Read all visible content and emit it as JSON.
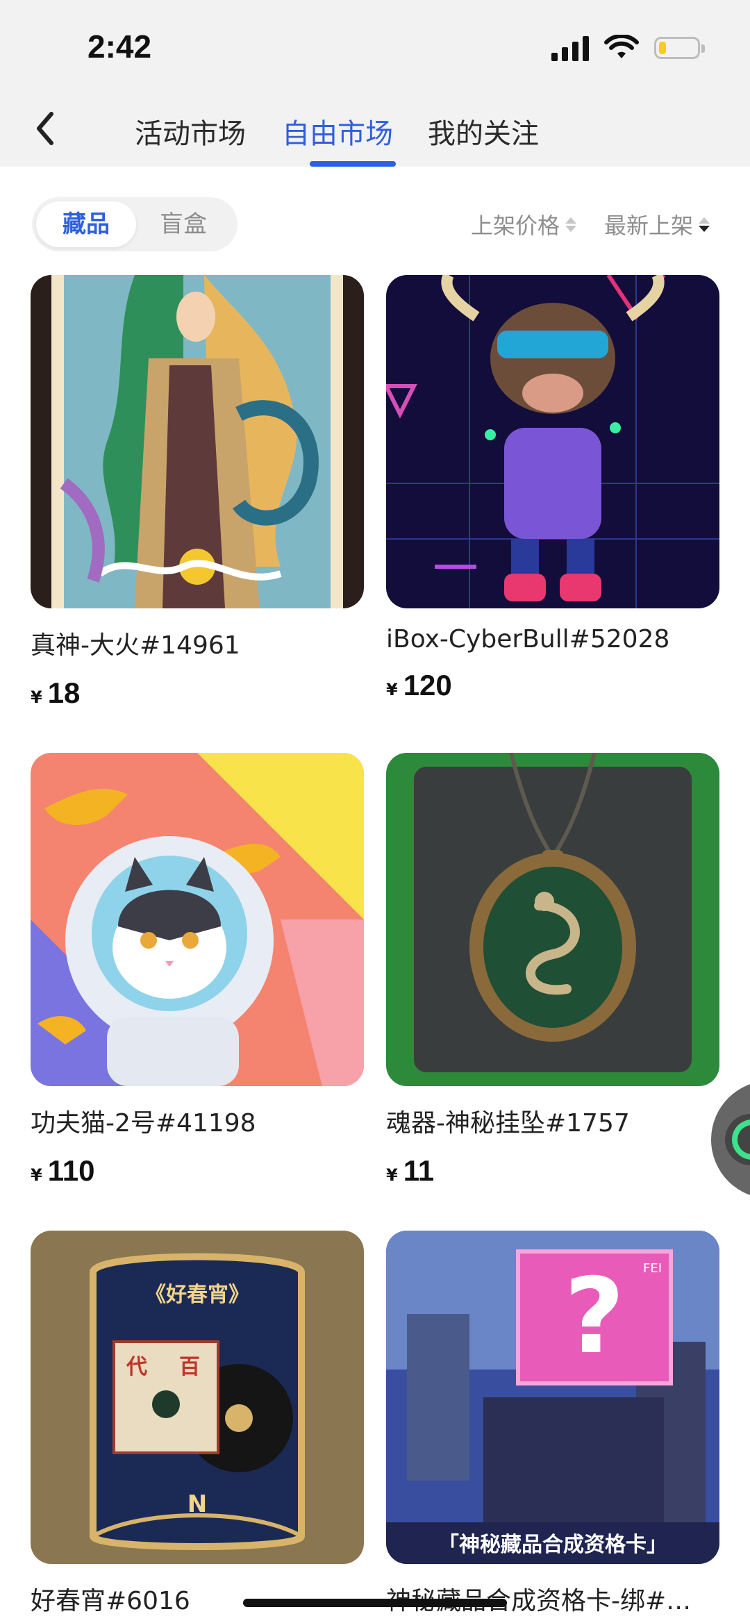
{
  "status_bar": {
    "time": "2:42"
  },
  "nav": {
    "tabs": [
      {
        "label": "活动市场"
      },
      {
        "label": "自由市场"
      },
      {
        "label": "我的关注"
      }
    ],
    "active_tab": "自由市场"
  },
  "filter": {
    "segments": [
      {
        "label": "藏品"
      },
      {
        "label": "盲盒"
      }
    ],
    "sort_price": "上架价格",
    "sort_newest": "最新上架"
  },
  "currency_symbol": "¥",
  "items": [
    {
      "title": "真神-大火#14961",
      "price": "18",
      "image": "dragon-goddess-artwork"
    },
    {
      "title": "iBox-CyberBull#52028",
      "price": "120",
      "image": "cyber-bull-artwork"
    },
    {
      "title": "功夫猫-2号#41198",
      "price": "110",
      "image": "astronaut-cat-artwork"
    },
    {
      "title": "魂器-神秘挂坠#1757",
      "price": "11",
      "image": "serpent-pendant-artwork"
    },
    {
      "title": "好春宵#6016",
      "price": "",
      "image": "vinyl-record-artwork"
    },
    {
      "title": "神秘藏品合成资格卡-绑#…",
      "price": "",
      "image": "mystery-card-artwork",
      "image_caption": "「神秘藏品合成资格卡」",
      "image_sign": "FEI"
    }
  ],
  "item4_image_text": {
    "top": "《好春宵》",
    "badge_left": "代",
    "badge_right": "百",
    "bottom": "N"
  }
}
